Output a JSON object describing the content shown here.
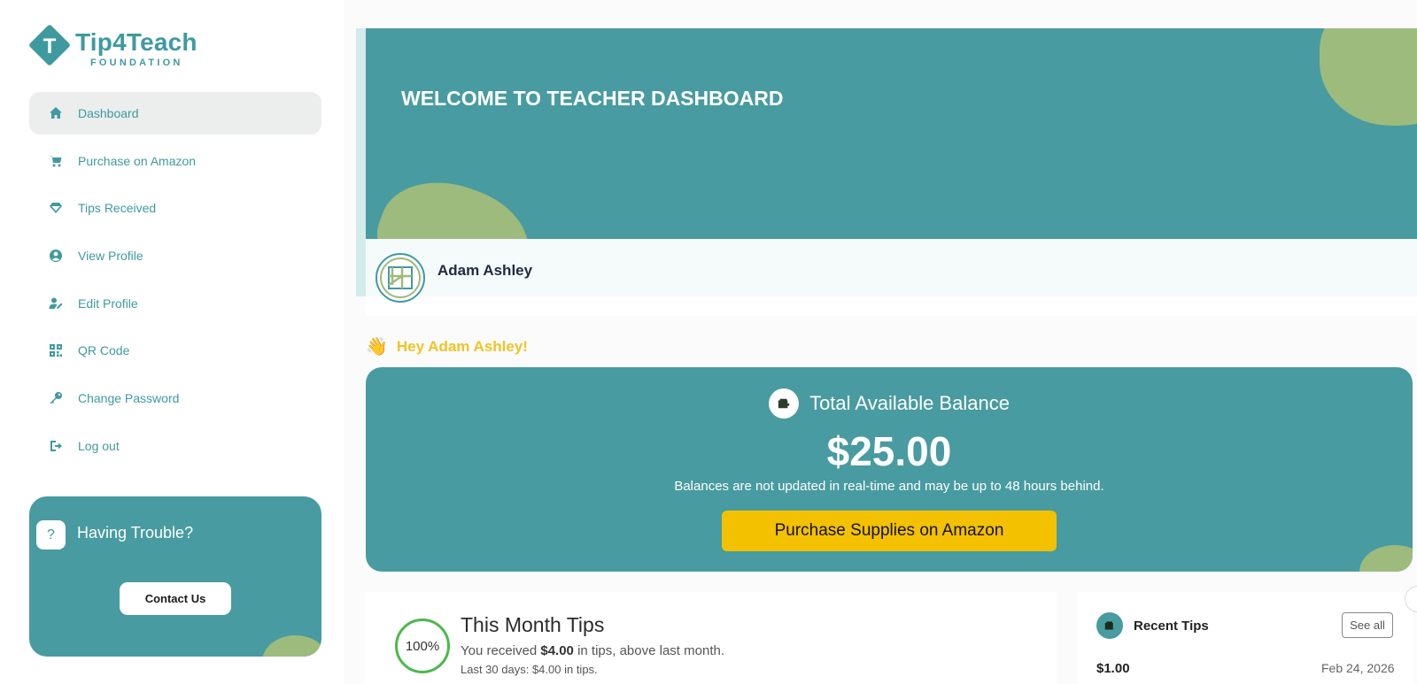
{
  "brand": {
    "name": "Tip4Teach",
    "sub": "FOUNDATION",
    "mark": "T",
    "color": "#3f9aa0"
  },
  "sidebar": {
    "items": [
      {
        "label": "Dashboard",
        "icon": "home-icon",
        "active": true
      },
      {
        "label": "Purchase on Amazon",
        "icon": "cart-icon"
      },
      {
        "label": "Tips Received",
        "icon": "diamond-icon"
      },
      {
        "label": "View Profile",
        "icon": "user-circle-icon"
      },
      {
        "label": "Edit Profile",
        "icon": "user-edit-icon"
      },
      {
        "label": "QR Code",
        "icon": "qrcode-icon"
      },
      {
        "label": "Change Password",
        "icon": "key-icon"
      },
      {
        "label": "Log out",
        "icon": "logout-icon"
      }
    ],
    "help": {
      "icon_text": "?",
      "title": "Having Trouble?",
      "button": "Contact Us"
    }
  },
  "hero": {
    "title": "WELCOME TO TEACHER DASHBOARD"
  },
  "profile": {
    "name": "Adam Ashley"
  },
  "greeting": {
    "wave": "👋",
    "text": "Hey Adam Ashley!"
  },
  "balance": {
    "title": "Total Available Balance",
    "amount": "$25.00",
    "note": "Balances are not updated in real-time and may be up to 48 hours behind.",
    "button": "Purchase Supplies on Amazon"
  },
  "month_tips": {
    "progress": "100%",
    "title": "This Month Tips",
    "line_prefix": "You received ",
    "line_amount": "$4.00",
    "line_suffix": " in tips, above last month.",
    "sub": "Last 30 days: $4.00 in tips."
  },
  "recent_tips": {
    "title": "Recent Tips",
    "see_all": "See all",
    "items": [
      {
        "amount": "$1.00",
        "date": "Feb 24, 2026"
      }
    ]
  },
  "colors": {
    "teal": "#489ba0",
    "green": "#9dbb7c",
    "yellow": "#f4c100",
    "greeting": "#f0c426"
  }
}
